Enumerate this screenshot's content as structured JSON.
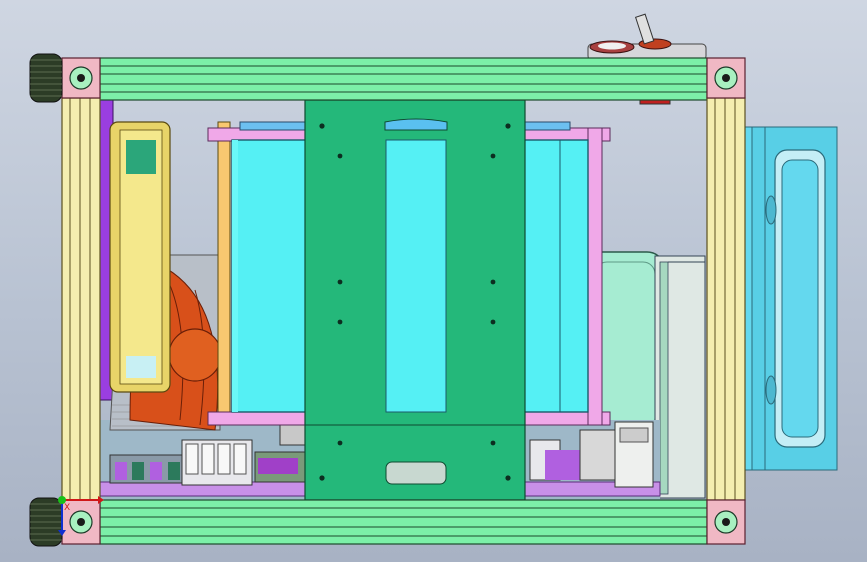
{
  "viewport": {
    "background_top": "#cfd6e2",
    "background_bottom": "#a8b2c4"
  },
  "colors": {
    "frame_rail": "#7cf0a8",
    "frame_post": "#f4eeb0",
    "corner_bracket": "#f0b8c4",
    "knob": "#2c3c26",
    "fan_frame": "#e8d468",
    "fan_blade": "#d8501a",
    "fan_housing_purple": "#9a3ee0",
    "psu_body": "#55f0f4",
    "bracket_green": "#24b87a",
    "tray_pink": "#f0a8e8",
    "battery_plate": "#a6ecd2",
    "handle_cyan": "#60d8ee",
    "pcb_purple": "#c890e8",
    "header_orange": "#f8c870"
  },
  "triad": {
    "x_axis_label": "X"
  }
}
